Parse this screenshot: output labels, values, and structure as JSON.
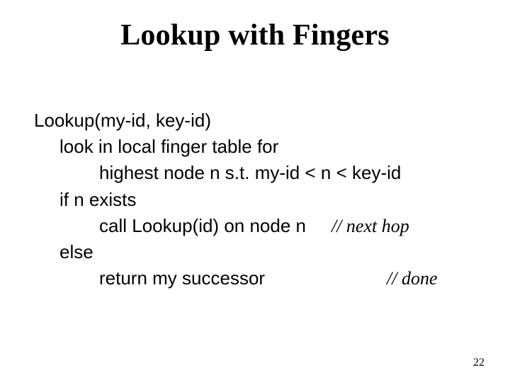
{
  "title": "Lookup with Fingers",
  "lines": {
    "sig": "Lookup(my-id, key-id)",
    "look": "look in local finger table for",
    "highest": "highest node n s.t. my-id < n < key-id",
    "ifn": "if n exists",
    "call": "call Lookup(id) on node n",
    "call_comment": "// next hop",
    "else": "else",
    "return": "return my successor",
    "return_comment": "// done"
  },
  "page_number": "22"
}
